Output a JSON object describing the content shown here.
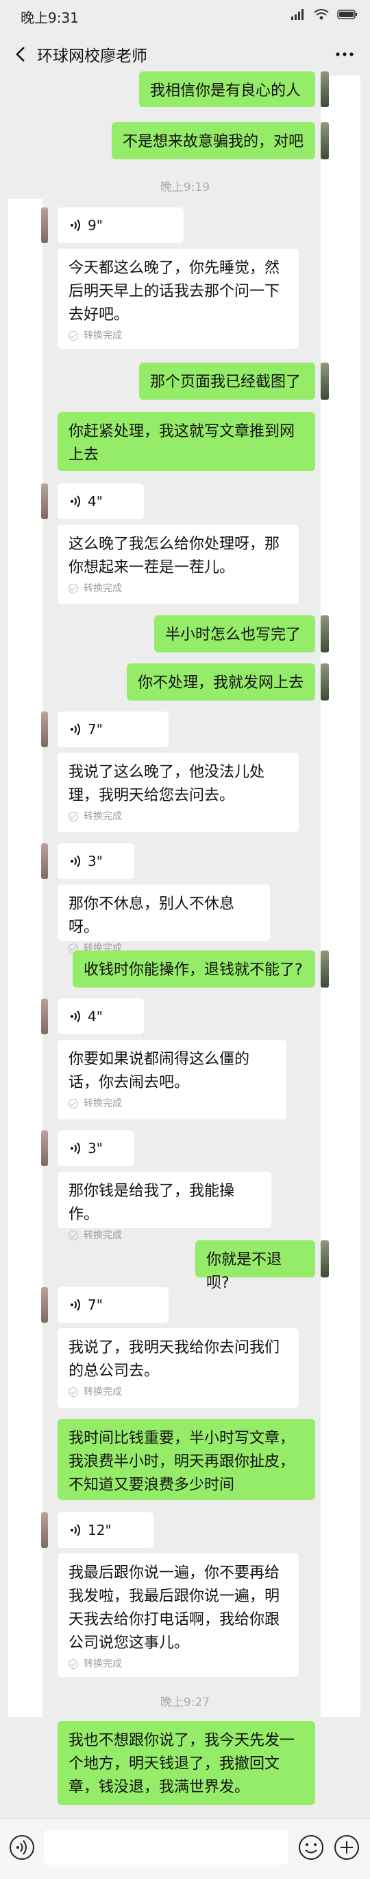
{
  "status_bar": {
    "time": "晚上9:31"
  },
  "header": {
    "title": "环球网校廖老师"
  },
  "timestamps": {
    "t1": "晚上9:19",
    "t2": "晚上9:27"
  },
  "transcribe_status": "转换完成",
  "messages": {
    "m1": "我相信你是有良心的人",
    "m2": "不是想来故意骗我的，对吧",
    "v1": {
      "duration": "9\"",
      "text": "今天都这么晚了，你先睡觉，然后明天早上的话我去那个问一下去好吧。"
    },
    "m3": "那个页面我已经截图了",
    "m4": "你赶紧处理，我这就写文章推到网上去",
    "v2": {
      "duration": "4\"",
      "text": "这么晚了我怎么给你处理呀，那你想起来一茬是一茬儿。"
    },
    "m5": "半小时怎么也写完了",
    "m6": "你不处理，我就发网上去",
    "v3": {
      "duration": "7\"",
      "text": "我说了这么晚了，他没法儿处理，我明天给您去问去。"
    },
    "v4": {
      "duration": "3\"",
      "text": "那你不休息，别人不休息呀。"
    },
    "m7": "收钱时你能操作，退钱就不能了?",
    "v5": {
      "duration": "4\"",
      "text": "你要如果说都闹得这么僵的话，你去闹去吧。"
    },
    "v6": {
      "duration": "3\"",
      "text": "那你钱是给我了，我能操作。"
    },
    "m8": "你就是不退呗?",
    "v7": {
      "duration": "7\"",
      "text": "我说了，我明天我给你去问我们的总公司去。"
    },
    "m9": "我时间比钱重要，半小时写文章，我浪费半小时，明天再跟你扯皮，不知道又要浪费多少时间",
    "v8": {
      "duration": "12\"",
      "text": "我最后跟你说一遍，你不要再给我发啦，我最后跟你说一遍，明天我去给你打电话啊，我给你跟公司说您这事儿。"
    },
    "m10": "我也不想跟你说了，我今天先发一个地方，明天钱退了，我撤回文章，钱没退，我满世界发。"
  }
}
